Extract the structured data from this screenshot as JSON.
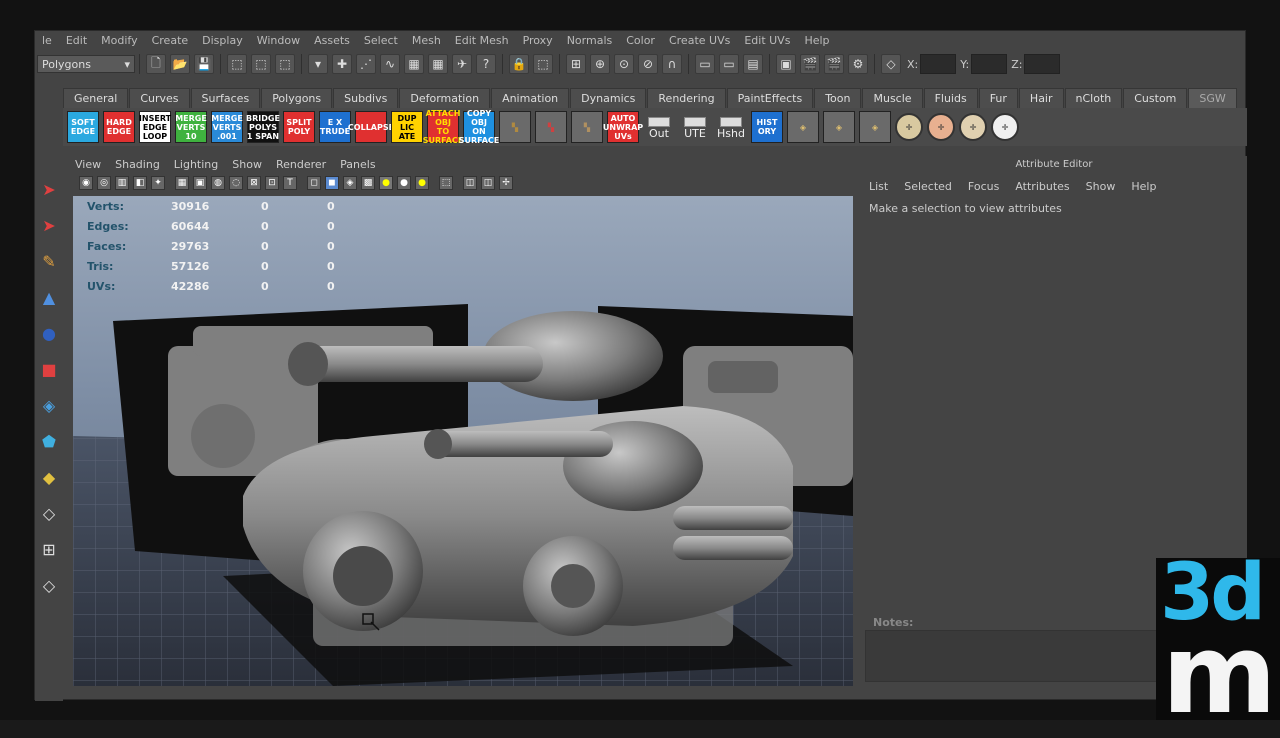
{
  "menubar": [
    "le",
    "Edit",
    "Modify",
    "Create",
    "Display",
    "Window",
    "Assets",
    "Select",
    "Mesh",
    "Edit Mesh",
    "Proxy",
    "Normals",
    "Color",
    "Create UVs",
    "Edit UVs",
    "Help"
  ],
  "statusline": {
    "mode": "Polygons",
    "coords": {
      "x_label": "X:",
      "y_label": "Y:",
      "z_label": "Z:"
    }
  },
  "shelf_tabs": [
    "General",
    "Curves",
    "Surfaces",
    "Polygons",
    "Subdivs",
    "Deformation",
    "Animation",
    "Dynamics",
    "Rendering",
    "PaintEffects",
    "Toon",
    "Muscle",
    "Fluids",
    "Fur",
    "Hair",
    "nCloth",
    "Custom",
    "SGW"
  ],
  "shelf_buttons": [
    {
      "label": "SOFT\nEDGE",
      "bg": "#2aa9e0",
      "fg": "#ffffff"
    },
    {
      "label": "HARD\nEDGE",
      "bg": "#e03030",
      "fg": "#ffffff"
    },
    {
      "label": "INSERT\nEDGE\nLOOP",
      "bg": "#ffffff",
      "fg": "#000000"
    },
    {
      "label": "MERGE\nVERTS\n10",
      "bg": "#3fb23f",
      "fg": "#ffffff"
    },
    {
      "label": "MERGE\nVERTS\n.001",
      "bg": "#2a8ad8",
      "fg": "#ffffff"
    },
    {
      "label": "BRIDGE\nPOLYS\n1 SPAN",
      "bg": "#111111",
      "fg": "#ffffff"
    },
    {
      "label": "SPLIT\nPOLY",
      "bg": "#e03030",
      "fg": "#ffffff"
    },
    {
      "label": "E X\nTRUDE",
      "bg": "#1e70d0",
      "fg": "#ffffff"
    },
    {
      "label": "COLLAPSE",
      "bg": "#e03030",
      "fg": "#ffffff"
    },
    {
      "label": "DUP\nLIC\nATE",
      "bg": "#ffd200",
      "fg": "#000000"
    },
    {
      "label": "ATTACH\nOBJ\nTO\nSURFACE",
      "bg": "#e03030",
      "fg": "#ffdd00"
    },
    {
      "label": "COPY\nOBJ\nON\nSURFACE",
      "bg": "#1e90e0",
      "fg": "#ffffff"
    }
  ],
  "shelf_buttons_2": [
    {
      "label": "AUTO\nUNWRAP\nUVs",
      "bg": "#e03030",
      "fg": "#ffffff"
    }
  ],
  "shelf_text_buttons": [
    "Out",
    "UTE",
    "Hshd"
  ],
  "shelf_hist": {
    "label": "HIST\nORY",
    "bg": "#1e70d0",
    "fg": "#ffffff"
  },
  "viewport_menu": [
    "View",
    "Shading",
    "Lighting",
    "Show",
    "Renderer",
    "Panels"
  ],
  "hud": [
    {
      "label": "Verts:",
      "v1": "30916",
      "v2": "0",
      "v3": "0"
    },
    {
      "label": "Edges:",
      "v1": "60644",
      "v2": "0",
      "v3": "0"
    },
    {
      "label": "Faces:",
      "v1": "29763",
      "v2": "0",
      "v3": "0"
    },
    {
      "label": "Tris:",
      "v1": "57126",
      "v2": "0",
      "v3": "0"
    },
    {
      "label": "UVs:",
      "v1": "42286",
      "v2": "0",
      "v3": "0"
    }
  ],
  "attribute_editor": {
    "title": "Attribute Editor",
    "menu": [
      "List",
      "Selected",
      "Focus",
      "Attributes",
      "Show",
      "Help"
    ],
    "message": "Make a selection to view attributes",
    "notes_label": "Notes:"
  },
  "logo": {
    "top": "3d",
    "bottom": "m",
    "top_color": "#2fb8ea",
    "bottom_color": "#f4f4f4"
  }
}
